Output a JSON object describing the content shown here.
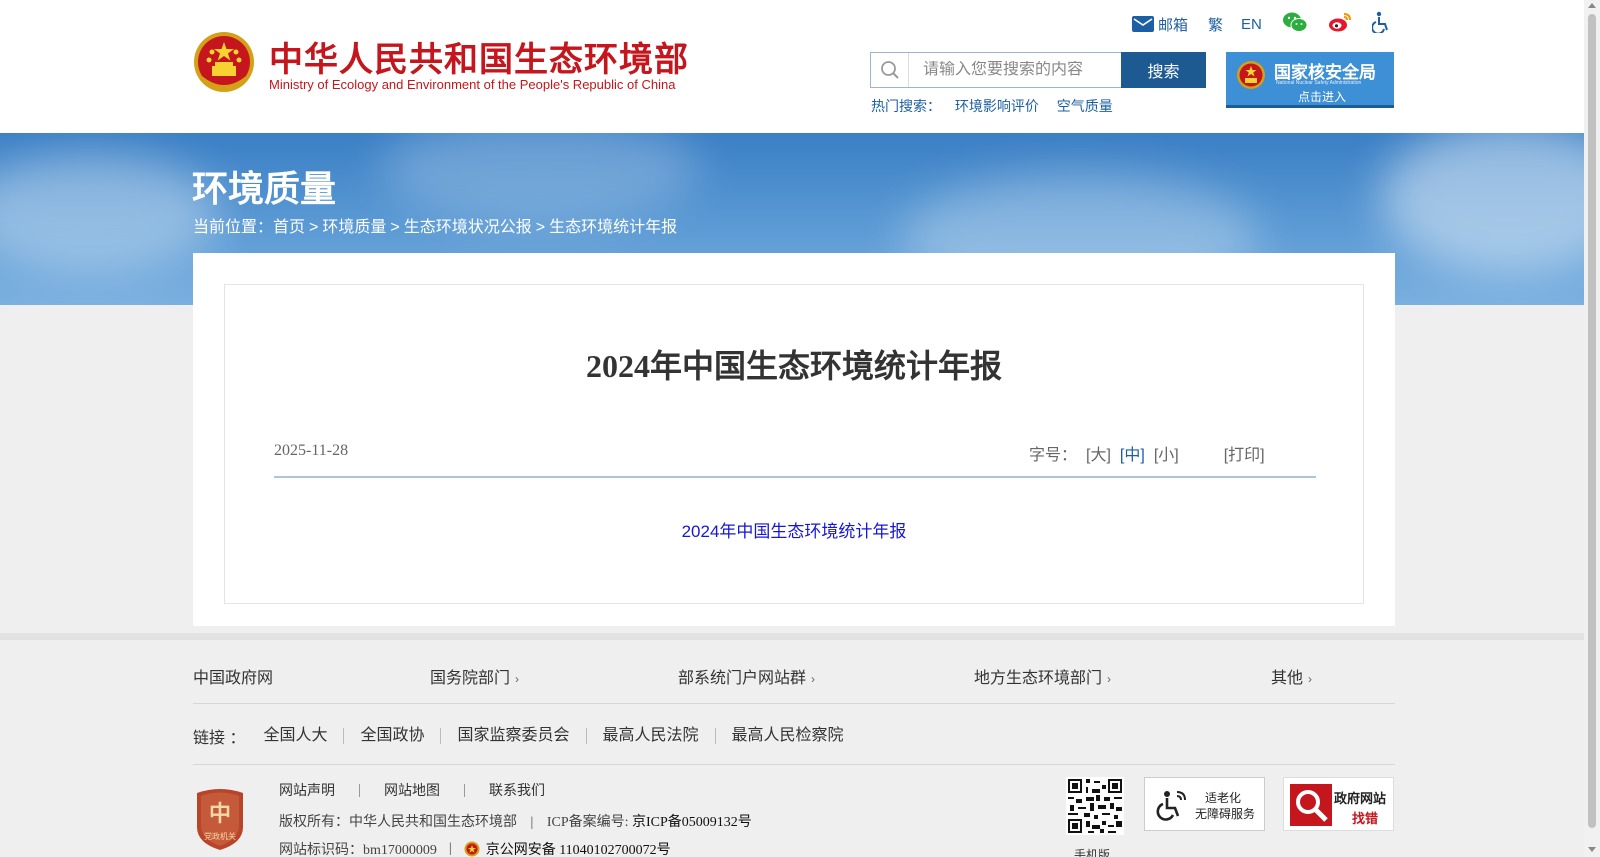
{
  "header": {
    "site_title": "中华人民共和国生态环境部",
    "site_subtitle": "Ministry of Ecology and Environment of the People's Republic of China",
    "top_links": {
      "mail": "邮箱",
      "traditional": "繁",
      "english": "EN"
    },
    "search": {
      "placeholder": "请输入您要搜索的内容",
      "button": "搜索",
      "hot_label": "热门搜索：",
      "hot_terms": [
        "环境影响评价",
        "空气质量"
      ]
    },
    "nnsa": {
      "title": "国家核安全局",
      "subtitle": "National Nuclear Safety Administration",
      "enter": "点击进入"
    }
  },
  "banner": {
    "title": "环境质量",
    "breadcrumb": {
      "label": "当前位置：",
      "items": [
        "首页",
        "环境质量",
        "生态环境状况公报",
        "生态环境统计年报"
      ],
      "separator": ">"
    }
  },
  "article": {
    "title": "2024年中国生态环境统计年报",
    "date": "2025-11-28",
    "font_size_label": "字号：",
    "font_sizes": [
      "[大]",
      "[中]",
      "[小]"
    ],
    "active_font_size": "[中]",
    "print": "[打印]",
    "attachment": "2024年中国生态环境统计年报"
  },
  "footer": {
    "nav": [
      "中国政府网",
      "国务院部门",
      "部系统门户网站群",
      "地方生态环境部门",
      "其他"
    ],
    "links_label": "链接 ：",
    "links": [
      "全国人大",
      "全国政协",
      "国家监察委员会",
      "最高人民法院",
      "最高人民检察院"
    ],
    "site_links": [
      "网站声明",
      "网站地图",
      "联系我们"
    ],
    "copyright": "版权所有：中华人民共和国生态环境部",
    "icp_label": "ICP备案编号:",
    "icp": "京ICP备05009132号",
    "site_id": "网站标识码：bm17000009",
    "police": "京公网安备 11040102700072号",
    "qr_label": "手机版",
    "access": [
      "适老化",
      "无障碍服务"
    ],
    "error": [
      "政府网站",
      "找错"
    ],
    "party_badge_text": "党政机关"
  },
  "colors": {
    "brand_red": "#c4161c",
    "link_blue": "#1d5fa5",
    "search_button": "#1d5a92",
    "attachment_link": "#1616d8"
  }
}
